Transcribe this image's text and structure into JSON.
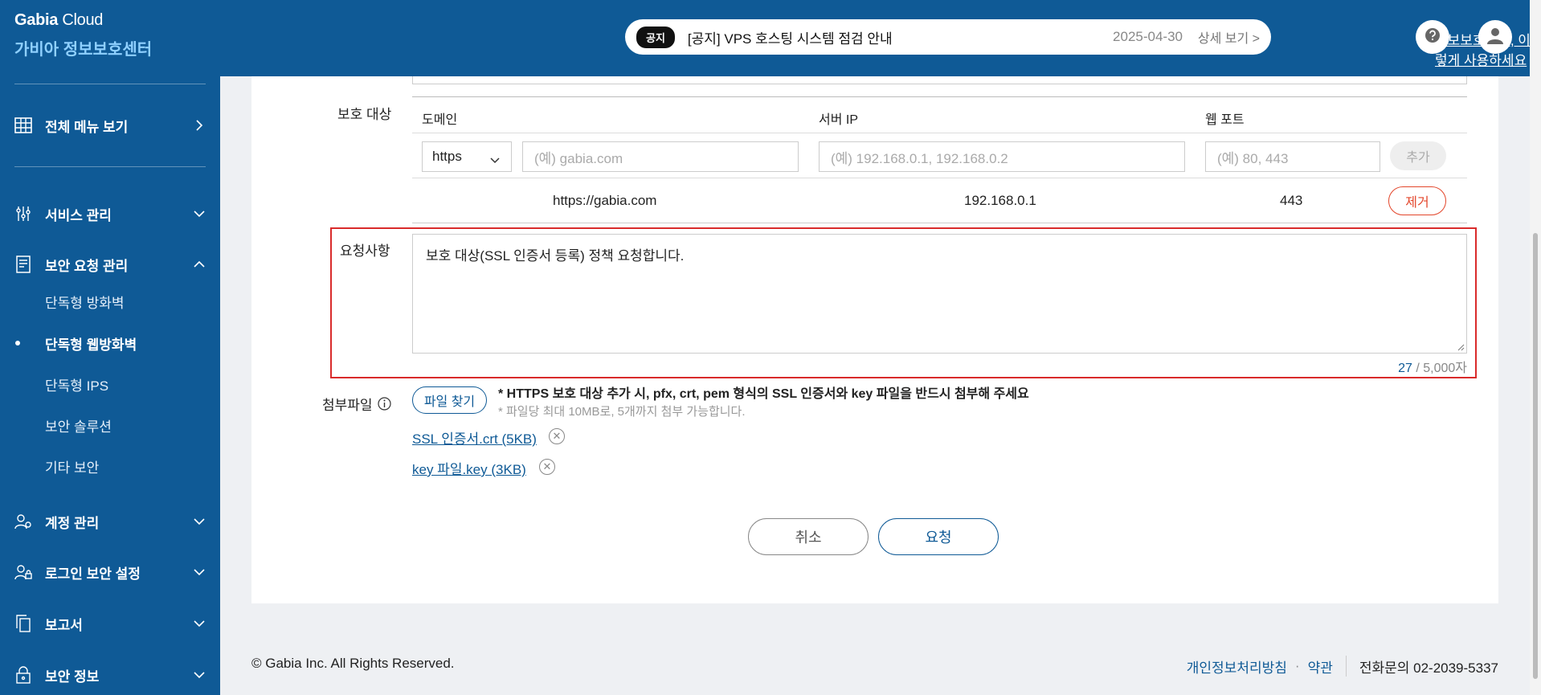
{
  "brand": {
    "company": "Gabia",
    "product": "Cloud",
    "center": "가비아 정보보호센터"
  },
  "sidebar": {
    "all_menu": "전체 메뉴 보기",
    "items": [
      {
        "label": "서비스 관리",
        "icon": "sliders-icon"
      },
      {
        "label": "보안 요청 관리",
        "icon": "document-icon"
      },
      {
        "label": "계정 관리",
        "icon": "user-gear-icon"
      },
      {
        "label": "로그인 보안 설정",
        "icon": "user-lock-icon"
      },
      {
        "label": "보고서",
        "icon": "copy-icon"
      },
      {
        "label": "보안 정보",
        "icon": "lock-icon"
      }
    ],
    "subitems": [
      "단독형 방화벽",
      "단독형 웹방화벽",
      "단독형 IPS",
      "보안 솔루션",
      "기타 보안"
    ],
    "active_subitem": "단독형 웹방화벽"
  },
  "notice": {
    "tag": "공지",
    "title": "[공지] VPS 호스팅 시스템 점검 안내",
    "date": "2025-04-30",
    "more": "상세 보기 >"
  },
  "header": {
    "help_link": "정보보호센터, 이렇게 사용하세요"
  },
  "form": {
    "protect_label": "보호 대상",
    "columns": {
      "domain": "도메인",
      "server_ip": "서버 IP",
      "web_port": "웹 포트"
    },
    "protocol": "https",
    "placeholders": {
      "domain": "(예) gabia.com",
      "server_ip": "(예) 192.168.0.1, 192.168.0.2",
      "port": "(예) 80, 443"
    },
    "add_button": "추가",
    "row": {
      "domain": "https://gabia.com",
      "ip": "192.168.0.1",
      "port": "443",
      "remove": "제거"
    },
    "request_label": "요청사항",
    "request_text": "보호 대상(SSL 인증서 등록) 정책 요청합니다.",
    "counter": {
      "count": "27",
      "max": "/ 5,000자"
    },
    "attach_label": "첨부파일",
    "file_button": "파일 찾기",
    "hint_main": "* HTTPS 보호 대상 추가 시, pfx, crt, pem 형식의 SSL 인증서와 key 파일을 반드시 첨부해 주세요",
    "hint_sub": "* 파일당 최대 10MB로, 5개까지 첨부 가능합니다.",
    "files": [
      "SSL 인증서.crt (5KB)",
      "key 파일.key (3KB)"
    ],
    "cancel": "취소",
    "submit": "요청"
  },
  "footer": {
    "copyright": "© Gabia Inc. All Rights Reserved.",
    "privacy": "개인정보처리방침",
    "terms": "약관",
    "phone": "전화문의 02-2039-5337"
  }
}
